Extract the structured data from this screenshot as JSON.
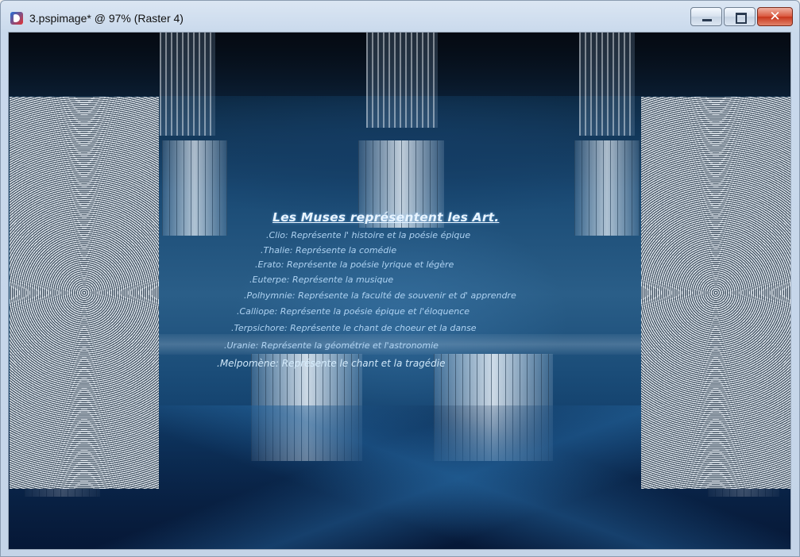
{
  "window": {
    "title": "3.pspimage* @  97% (Raster 4)",
    "app_icon": "paintshop-pro-icon",
    "buttons": [
      {
        "name": "minimize",
        "icon": "minimize-icon"
      },
      {
        "name": "maximize",
        "icon": "maximize-icon"
      },
      {
        "name": "close",
        "icon": "close-icon",
        "glyph": "✕"
      }
    ]
  },
  "canvas": {
    "heading": "Les Muses représentent les Art",
    "heading_suffix": ".",
    "muses": [
      ".Clio: Représente l' histoire et la poésie épique",
      ".Thalie: Représente la comédie",
      ".Erato: Représente la poésie lyrique et légère",
      ".Euterpe: Représente la musique",
      ".Polhymnie: Représente la faculté de souvenir et d' apprendre",
      ".Calliope: Représente la poésie épique et l'éloquence",
      ".Terpsichore: Représente le chant de choeur et la danse",
      ".Uranie: Représente la géométrie et l'astronomie",
      ".Melpomène: Représente le chant et la tragédie"
    ],
    "colors": {
      "background": "#1a4a74",
      "text": "#bfe1ff",
      "heading": "#e8f4ff"
    }
  }
}
